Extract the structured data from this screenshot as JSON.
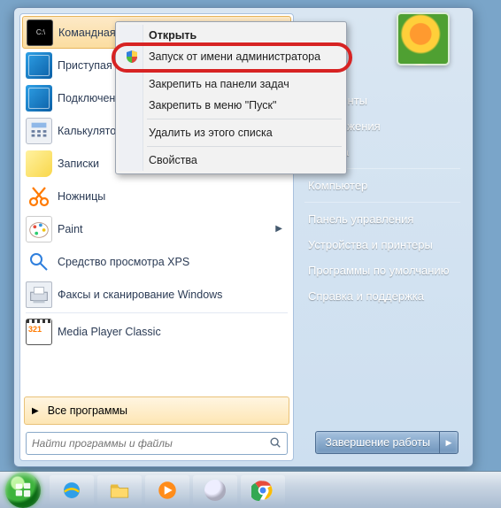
{
  "programs": [
    {
      "label": "Командная строка",
      "icon": "cmd-icon",
      "has_sub": true,
      "highlight": true
    },
    {
      "label": "Приступая к работе",
      "icon": "getting-started-icon",
      "has_sub": true
    },
    {
      "label": "Подключение к удаленному рабочему столу",
      "icon": "rdp-icon",
      "has_sub": false
    },
    {
      "label": "Калькулятор",
      "icon": "calc-icon",
      "has_sub": true
    },
    {
      "label": "Записки",
      "icon": "sticky-notes-icon",
      "has_sub": false
    },
    {
      "label": "Ножницы",
      "icon": "snipping-tool-icon",
      "has_sub": false
    },
    {
      "label": "Paint",
      "icon": "paint-icon",
      "has_sub": true
    },
    {
      "label": "Средство просмотра XPS",
      "icon": "xps-viewer-icon",
      "has_sub": false
    },
    {
      "label": "Факсы и сканирование Windows",
      "icon": "fax-scan-icon",
      "has_sub": false
    },
    {
      "label": "Media Player Classic",
      "icon": "mpc-icon",
      "has_sub": false
    }
  ],
  "all_programs_label": "Все программы",
  "search": {
    "placeholder": "Найти программы и файлы"
  },
  "right_links": {
    "group1": [
      "Документы",
      "Изображения",
      "Музыка"
    ],
    "group2": [
      "Компьютер"
    ],
    "group3": [
      "Панель управления",
      "Устройства и принтеры",
      "Программы по умолчанию",
      "Справка и поддержка"
    ]
  },
  "shutdown_label": "Завершение работы",
  "context_menu": {
    "open": "Открыть",
    "run_as_admin": "Запуск от имени администратора",
    "pin_taskbar": "Закрепить на панели задач",
    "pin_start": "Закрепить в меню \"Пуск\"",
    "remove": "Удалить из этого списка",
    "properties": "Свойства"
  },
  "taskbar_icons": [
    "start-orb",
    "ie-icon",
    "explorer-icon",
    "wmp-icon",
    "generic-app-icon",
    "chrome-icon"
  ]
}
